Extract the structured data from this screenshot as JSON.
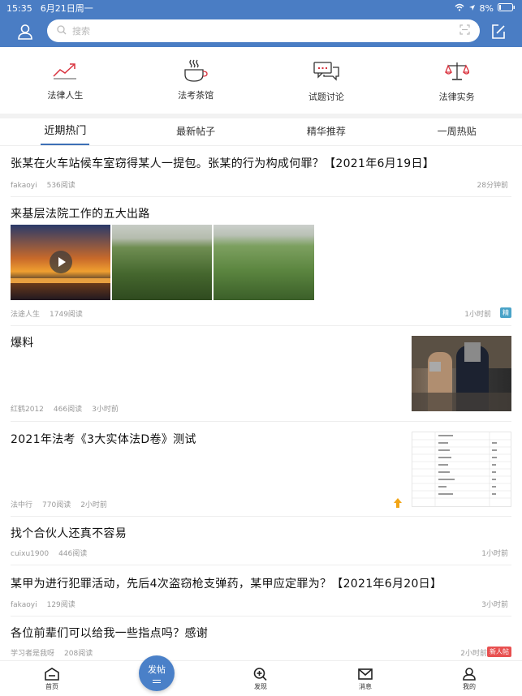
{
  "status": {
    "time": "15:35",
    "date": "6月21日周一",
    "battery": "8%"
  },
  "search": {
    "placeholder": "搜索"
  },
  "categories": [
    {
      "label": "法律人生",
      "icon": "trend-chart-icon"
    },
    {
      "label": "法考茶馆",
      "icon": "coffee-cup-icon"
    },
    {
      "label": "试题讨论",
      "icon": "chat-bubbles-icon"
    },
    {
      "label": "法律实务",
      "icon": "scales-icon"
    }
  ],
  "tabs": [
    "近期热门",
    "最新帖子",
    "精华推荐",
    "一周热贴"
  ],
  "posts": [
    {
      "title": "张某在火车站候车室窃得某人一提包。张某的行为构成何罪？【2021年6月19日】",
      "author": "fakaoyi",
      "reads": "536阅读",
      "time": "28分钟前"
    },
    {
      "title": "来基层法院工作的五大出路",
      "author": "法途人生",
      "reads": "1749阅读",
      "time": "1小时前",
      "tag": "精"
    },
    {
      "title": "爆料",
      "author": "红鹤2012",
      "reads": "466阅读",
      "time": "3小时前"
    },
    {
      "title": "2021年法考《3大实体法D卷》测试",
      "author": "法中行",
      "reads": "770阅读",
      "time": "2小时前"
    },
    {
      "title": "找个合伙人还真不容易",
      "author": "cuixu1900",
      "reads": "446阅读",
      "time": "1小时前"
    },
    {
      "title": "某甲为进行犯罪活动，先后4次盗窃枪支弹药，某甲应定罪为？【2021年6月20日】",
      "author": "fakaoyi",
      "reads": "129阅读",
      "time": "3小时前"
    },
    {
      "title": "各位前辈们可以给我一些指点吗？感谢",
      "author": "学习者是我呀",
      "reads": "208阅读",
      "time": "2小时前",
      "tag": "新人帖"
    }
  ],
  "bottom": {
    "home": "首页",
    "post": "发帖",
    "discover": "发现",
    "messages": "消息",
    "me": "我的"
  }
}
